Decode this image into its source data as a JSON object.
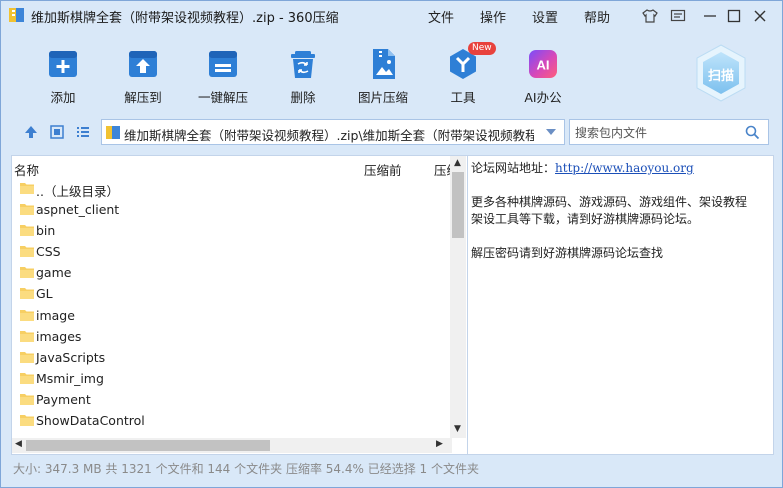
{
  "window": {
    "title": "维加斯棋牌全套（附带架设视频教程）.zip - 360压缩",
    "menu": [
      "文件",
      "操作",
      "设置",
      "帮助"
    ]
  },
  "toolbar": {
    "tools": [
      {
        "label": "添加",
        "icon": "add-icon"
      },
      {
        "label": "解压到",
        "icon": "extract-to-icon"
      },
      {
        "label": "一键解压",
        "icon": "one-click-extract-icon"
      },
      {
        "label": "删除",
        "icon": "trash-icon"
      },
      {
        "label": "图片压缩",
        "icon": "image-compress-icon"
      },
      {
        "label": "工具",
        "icon": "tools-icon",
        "badge": "New"
      },
      {
        "label": "AI办公",
        "icon": "ai-office-icon",
        "glyph": "AI"
      }
    ],
    "scan_label": "扫描"
  },
  "address": {
    "path": "维加斯棋牌全套（附带架设视频教程）.zip\\维加斯全套（附带架设视频教程",
    "search_placeholder": "搜索包内文件"
  },
  "filelist": {
    "columns": [
      "名称",
      "压缩前",
      "压缩"
    ],
    "rows": [
      "..（上级目录）",
      "aspnet_client",
      "bin",
      "CSS",
      "game",
      "GL",
      "image",
      "images",
      "JavaScripts",
      "Msmir_img",
      "Payment",
      "ShowDataControl"
    ]
  },
  "info": {
    "line1_prefix": "论坛网站地址：",
    "line1_link": "http://www.haoyou.org",
    "line2": "更多各种棋牌源码、游戏源码、游戏组件、架设教程",
    "line3": "架设工具等下载，请到好游棋牌源码论坛。",
    "line4": "解压密码请到好游棋牌源码论坛查找"
  },
  "status": "大小: 347.3 MB 共 1321 个文件和 144 个文件夹 压缩率 54.4% 已经选择 1 个文件夹",
  "colors": {
    "accent": "#2e7fd6",
    "folder": "#f7cf63",
    "link": "#1b4fb8"
  }
}
